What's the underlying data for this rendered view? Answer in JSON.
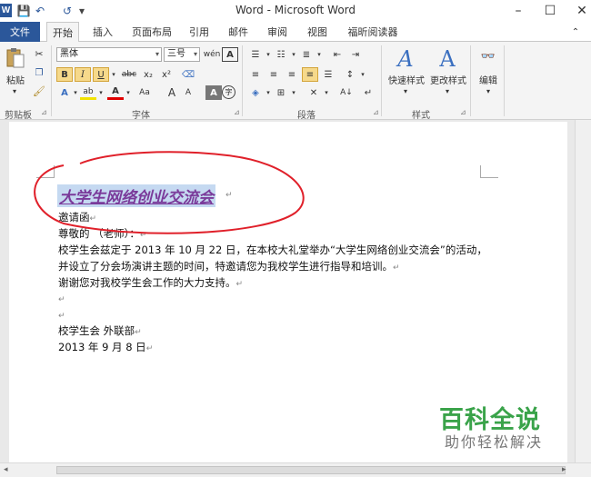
{
  "window": {
    "title": "Word - Microsoft Word",
    "app_badge": "W",
    "controls": {
      "minimize": "–",
      "maximize": "☐",
      "close": "✕"
    }
  },
  "quick_access": {
    "save": "💾",
    "undo": "↶",
    "redo": "↺",
    "customize": "▾"
  },
  "tabs": [
    "文件",
    "开始",
    "插入",
    "页面布局",
    "引用",
    "邮件",
    "审阅",
    "视图",
    "福昕阅读器"
  ],
  "active_tab": "开始",
  "ribbon": {
    "clipboard": {
      "label": "剪贴板",
      "paste": "粘贴"
    },
    "font": {
      "label": "字体",
      "font_name": "黑体",
      "font_size": "三号",
      "bold": "B",
      "italic": "I",
      "underline": "U",
      "strike": "abc",
      "subscript": "x₂",
      "superscript": "x²",
      "change_case": "Aa",
      "grow": "A",
      "shrink": "A",
      "wen": "wén",
      "char_border": "A"
    },
    "paragraph": {
      "label": "段落"
    },
    "styles": {
      "label": "样式",
      "quick_styles": "快速样式",
      "change_styles": "更改样式"
    },
    "editing": {
      "label": "编辑"
    }
  },
  "document": {
    "heading": "大学生网络创业交流会",
    "lines": [
      "邀请函",
      "尊敬的          （老师）：",
      "校学生会兹定于 2013 年 10 月 22 日，在本校大礼堂举办“大学生网络创业交流会”的活动，",
      "并设立了分会场演讲主题的时间，特邀请您为我校学生进行指导和培训。",
      "谢谢您对我校学生会工作的大力支持。",
      "",
      "",
      "校学生会 外联部",
      "2013 年 9 月 8 日"
    ]
  },
  "watermark": {
    "title": "百科全说",
    "subtitle": "助你轻松解决"
  },
  "colors": {
    "file_tab": "#2b579a",
    "heading_text": "#7a3a9a",
    "highlight": "#c5d9f1",
    "annotation_circle": "#e0202a",
    "watermark": "#3aa34a"
  }
}
